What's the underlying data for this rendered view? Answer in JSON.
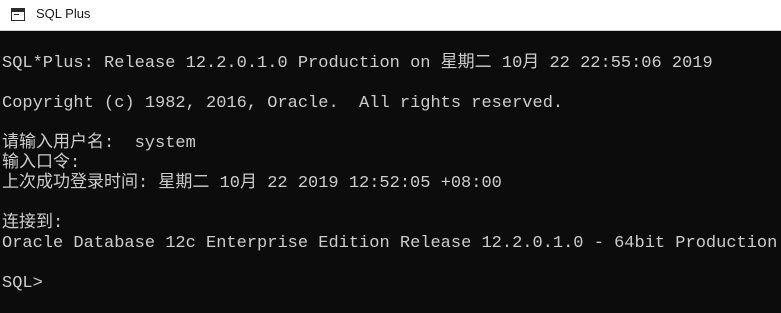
{
  "window": {
    "title": "SQL Plus"
  },
  "console": {
    "lines": [
      "SQL*Plus: Release 12.2.0.1.0 Production on 星期二 10月 22 22:55:06 2019",
      "Copyright (c) 1982, 2016, Oracle.  All rights reserved.",
      "请输入用户名:  system",
      "输入口令:",
      "上次成功登录时间: 星期二 10月 22 2019 12:52:05 +08:00",
      "连接到:",
      "Oracle Database 12c Enterprise Edition Release 12.2.0.1.0 - 64bit Production",
      "SQL>"
    ]
  },
  "icons": {
    "app_icon": "console-window-icon"
  },
  "colors": {
    "console_background": "#0c0c0c",
    "console_text": "#cccccc",
    "titlebar_background": "#ffffff"
  }
}
